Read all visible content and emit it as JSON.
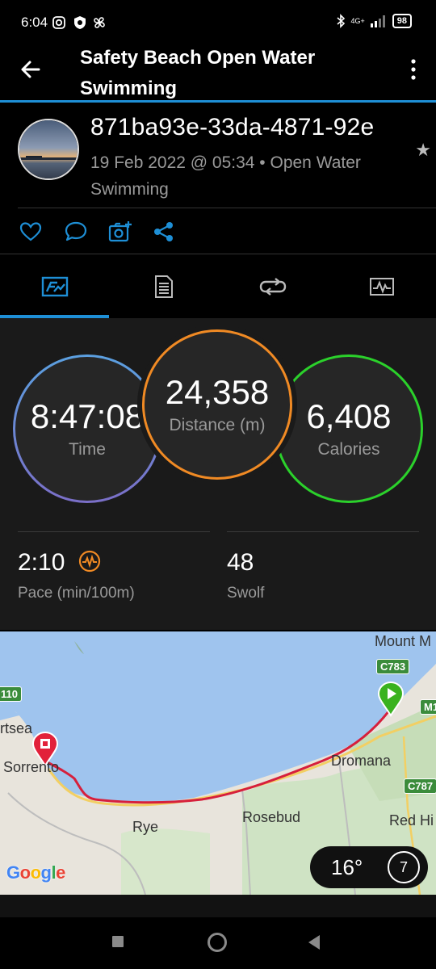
{
  "status_bar": {
    "time": "6:04",
    "network": "4G+",
    "battery": "98"
  },
  "header": {
    "title": "Safety Beach Open Water Swimming"
  },
  "activity": {
    "name": "871ba93e-33da-4871-92e",
    "meta": "19 Feb 2022 @ 05:34 • Open Water Swimming"
  },
  "actions": [
    {
      "icon": "heart-icon"
    },
    {
      "icon": "comment-icon"
    },
    {
      "icon": "add-photo-icon"
    },
    {
      "icon": "share-icon"
    }
  ],
  "tabs": [
    {
      "icon": "stats-overview-icon",
      "selected": true
    },
    {
      "icon": "details-list-icon",
      "selected": false
    },
    {
      "icon": "laps-icon",
      "selected": false
    },
    {
      "icon": "charts-icon",
      "selected": false
    }
  ],
  "stats": {
    "time": {
      "value": "8:47:08",
      "label": "Time"
    },
    "distance": {
      "value": "24,358",
      "label": "Distance (m)"
    },
    "calories": {
      "value": "6,408",
      "label": "Calories"
    },
    "pace": {
      "value": "2:10",
      "label": "Pace (min/100m)"
    },
    "swolf": {
      "value": "48",
      "label": "Swolf"
    }
  },
  "colors": {
    "accent": "#1e8fd6",
    "time_ring": "#5b9bd5",
    "distance_ring": "#f08a24",
    "calories_ring": "#2bd12b",
    "route": "#d61f3c"
  },
  "map": {
    "labels": {
      "mount": "Mount M",
      "portsea": "rtsea",
      "sorrento": "Sorrento",
      "dromana": "Dromana",
      "rosebud": "Rosebud",
      "rye": "Rye",
      "red_hill": "Red Hi"
    },
    "roads": {
      "c783": "C783",
      "m1": "M1",
      "c787": "C787",
      "m10": "110"
    },
    "attribution": "Google",
    "weather": {
      "temp": "16°",
      "wind": "7"
    }
  }
}
